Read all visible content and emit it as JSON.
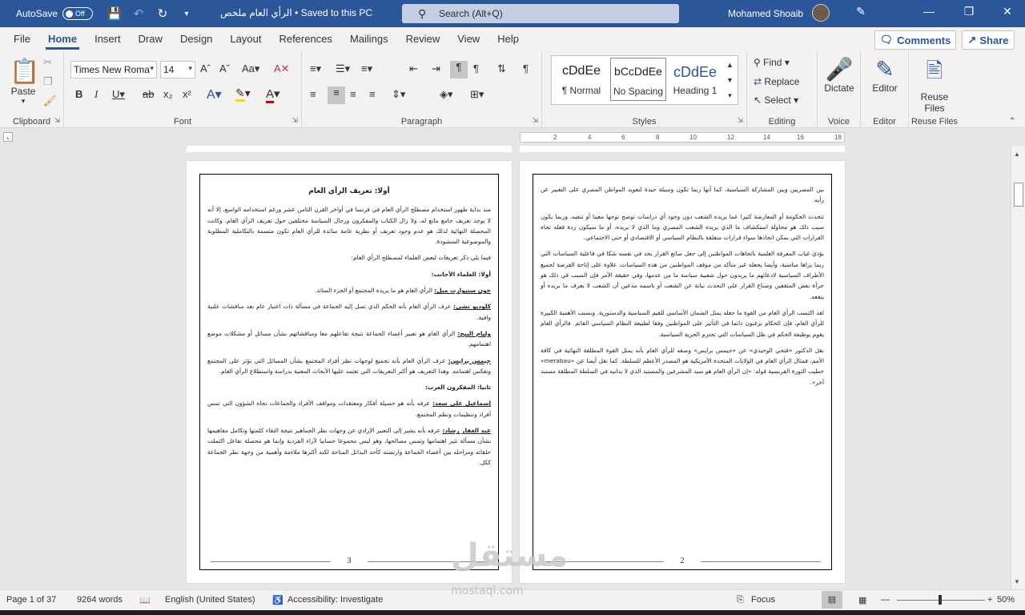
{
  "titlebar": {
    "autosave_label": "AutoSave",
    "autosave_state": "Off",
    "doc_title": "الرأي العام ملخص • Saved to this PC",
    "search_placeholder": "Search (Alt+Q)",
    "user_name": "Mohamed Shoaib"
  },
  "tabs": [
    "File",
    "Home",
    "Insert",
    "Draw",
    "Design",
    "Layout",
    "References",
    "Mailings",
    "Review",
    "View",
    "Help"
  ],
  "active_tab": "Home",
  "comments_label": "Comments",
  "share_label": "Share",
  "ribbon": {
    "clipboard": {
      "label": "Clipboard",
      "paste": "Paste"
    },
    "font": {
      "label": "Font",
      "font_name": "Times New Roma",
      "font_size": "14"
    },
    "paragraph": {
      "label": "Paragraph"
    },
    "styles": {
      "label": "Styles",
      "items": [
        {
          "sample": "cDdEe",
          "name": "¶ Normal"
        },
        {
          "sample": "bCcDdEe",
          "name": "No Spacing"
        },
        {
          "sample": "cDdEe",
          "name": "Heading 1"
        }
      ]
    },
    "editing": {
      "label": "Editing",
      "find": "Find",
      "replace": "Replace",
      "select": "Select"
    },
    "voice": {
      "label": "Voice",
      "dictate": "Dictate"
    },
    "editor": {
      "label": "Editor",
      "editor": "Editor"
    },
    "reuse": {
      "label": "Reuse Files",
      "reuse": "Reuse Files"
    }
  },
  "ruler_numbers": [
    "18",
    "16",
    "14",
    "12",
    "10",
    "8",
    "6",
    "4",
    "2"
  ],
  "pages": {
    "left": {
      "heading": "أولا: تعريف الرأي العام",
      "intro": "منذ بداية ظهور استخدام مصطلح الرأي العام في فرنسا في أواخر القرن الثامن عشر ورغم استخدامه الواسع، إلا أنه لا يوجد تعريف جامع مانع له، ولا زال الكتاب والمفكرون ورجال السياسة مختلفين حول تعريف الرأي العام. وكانت المحصلة النهائية لذلك هو عدم وجود تعريف أو نظرية عامة سائدة للرأي العام تكون متسمة بالتكاملية المطلوبة والموضوعية المنشودة.",
      "lead": "فيما يلي ذكر تعريفات لبعض العلماء لمصطلح الرأي العام:",
      "sub1": "أولا: العلماء الأجانب:",
      "d1_name": "جون ستيوارت ميل:",
      "d1_text": " الرأي العام هو ما يريده المجتمع أو الجزء السائد.",
      "d2_name": "كلوديو تشي:",
      "d2_text": " عرف الرأي العام بأنه الحكم الذي تصل إليه الجماعة في مسألة ذات اعتبار عام بعد مناقشات علنية وافية.",
      "d3_name": "وليام البيج:",
      "d3_text": " الرأي العام هو تعبير أعضاء الجماعة نتيجة تفاعلهم معا ومناقشاتهم بشأن مسائل أو مشكلات موضع اهتمامهم.",
      "d4_name": "جيمس برايس:",
      "d4_text": " عرف الرأي العام بأنه تجميع لوجهات نظر أفراد المجتمع بشأن المسائل التي تؤثر على المجتمع وتعكس اهتمامه. وهذا التعريف هو أكثر التعريفات التي تعتمد عليها الأبحاث المعنية بدراسة واستطلاع الرأي العام.",
      "sub2": "ثانيا: المفكرون العرب:",
      "d5_name": "إسماعيل علي سعد:",
      "d5_text": " عرفه بأنه هو حصيلة أفكار ومعتقدات ومواقف الأفراد والجماعات تجاه الشؤون التي تمس أفراد وتنظيمات ونظم المجتمع.",
      "d6_name": "عبد الغفار رشاد:",
      "d6_text": " عرفه بأنه يشير إلى التعبير الإرادي عن وجهات نظر الجماهير نتيجة التقاء كلمتها وتكامل مفاهيمها بشأن مسألة تثير اهتمامها وتمس مصالحها، وهو ليس مجموعا حسابيا لآراء الفردية وإنما هو محصلة تفاعل اكتملت حلقاته ومراحله بين أعضاء الجماعة وارتضته كأحد البدائل المتاحة لكنه أكثرها ملاءمة وأهمية من وجهة نظر الجماعة ككل.",
      "page_no": "3"
    },
    "right": {
      "p1": "بين المصريين وبين المشاركة السياسية، كما أنها ربما تكون وسيلة جيدة لتعويد المواطن المصري على التعبير عن رأيه.",
      "p2": "تتحدث الحكومة أو المعارضة كثيرا عما يريده الشعب دون وجود أي دراسات توضح توجها معينا أو تنفيه، وربما يكون سبب ذلك هو محاولة استكشاف ما الذي يريده الشعب المصري وما الذي لا يريده، أو ما سيكون ردة فعله تجاه القرارات التي يمكن اتخاذها سواء قرارات متعلقة بالنظام السياسي أو الاقتصادي أو حتى الاجتماعي.",
      "p3": "يؤدي غياب المعرفة العلمية باتجاهات المواطنين إلى جعل صانع القرار يجد في نفسه شكا في فاعلية السياسات التي ربما يراها مناسبة، وأيضا يجعله غير متأكد من موقف المواطنين من هذه السياسات، علاوة على إتاحة الفرصة لجميع الأطراف السياسية لادعائهم ما يريدون حول شعبية سياسة ما من عدمها، وفي حقيقة الأمر فإن السبب في ذلك هو جرأة بعض المثقفين وصناع القرار على التحدث نيابة عن الشعب أو باسمه مدعين أن الشعب لا يعرف ما يريده أو ينفعه.",
      "p4": "لقد اكتسب الرأي العام من القوة ما جعله يمثل الضمان الأساسي للقيم السياسية والدستورية. وبسبب الأهمية الكبيرة للرأي العام، فإن الحكام يرغبون دائما في التأثير على المواطنين وفقا لطبيعة النظام السياسي القائم. فالرأي العام يقوم بوظيفة الحكم في ظل السياسات التي تحترم الحرية السياسية.",
      "p5": "نقل الدكتور «فتحي الوحيدي» عن «جيمس برايس» وصفه للرأي العام بأنه يمثل القوة المطلقة النهائية في كافة الأمم، فمثال الرأي العام في الولايات المتحدة الأمريكية هو المصدر الأعظم للسلطة. كما نقل أيضا عن «merabau» خطيب الثورة الفرنسية قوله: «إن الرأي العام هو سيد المشرعين والمستبد الذي لا يدانيه في السلطة المطلقة مستبد آخر».",
      "page_no": "2"
    }
  },
  "watermark": {
    "main": "مستقل",
    "sub": "mostaql.com"
  },
  "statusbar": {
    "page": "Page 1 of 37",
    "words": "9264 words",
    "language": "English (United States)",
    "accessibility": "Accessibility: Investigate",
    "focus": "Focus",
    "zoom": "50%"
  }
}
